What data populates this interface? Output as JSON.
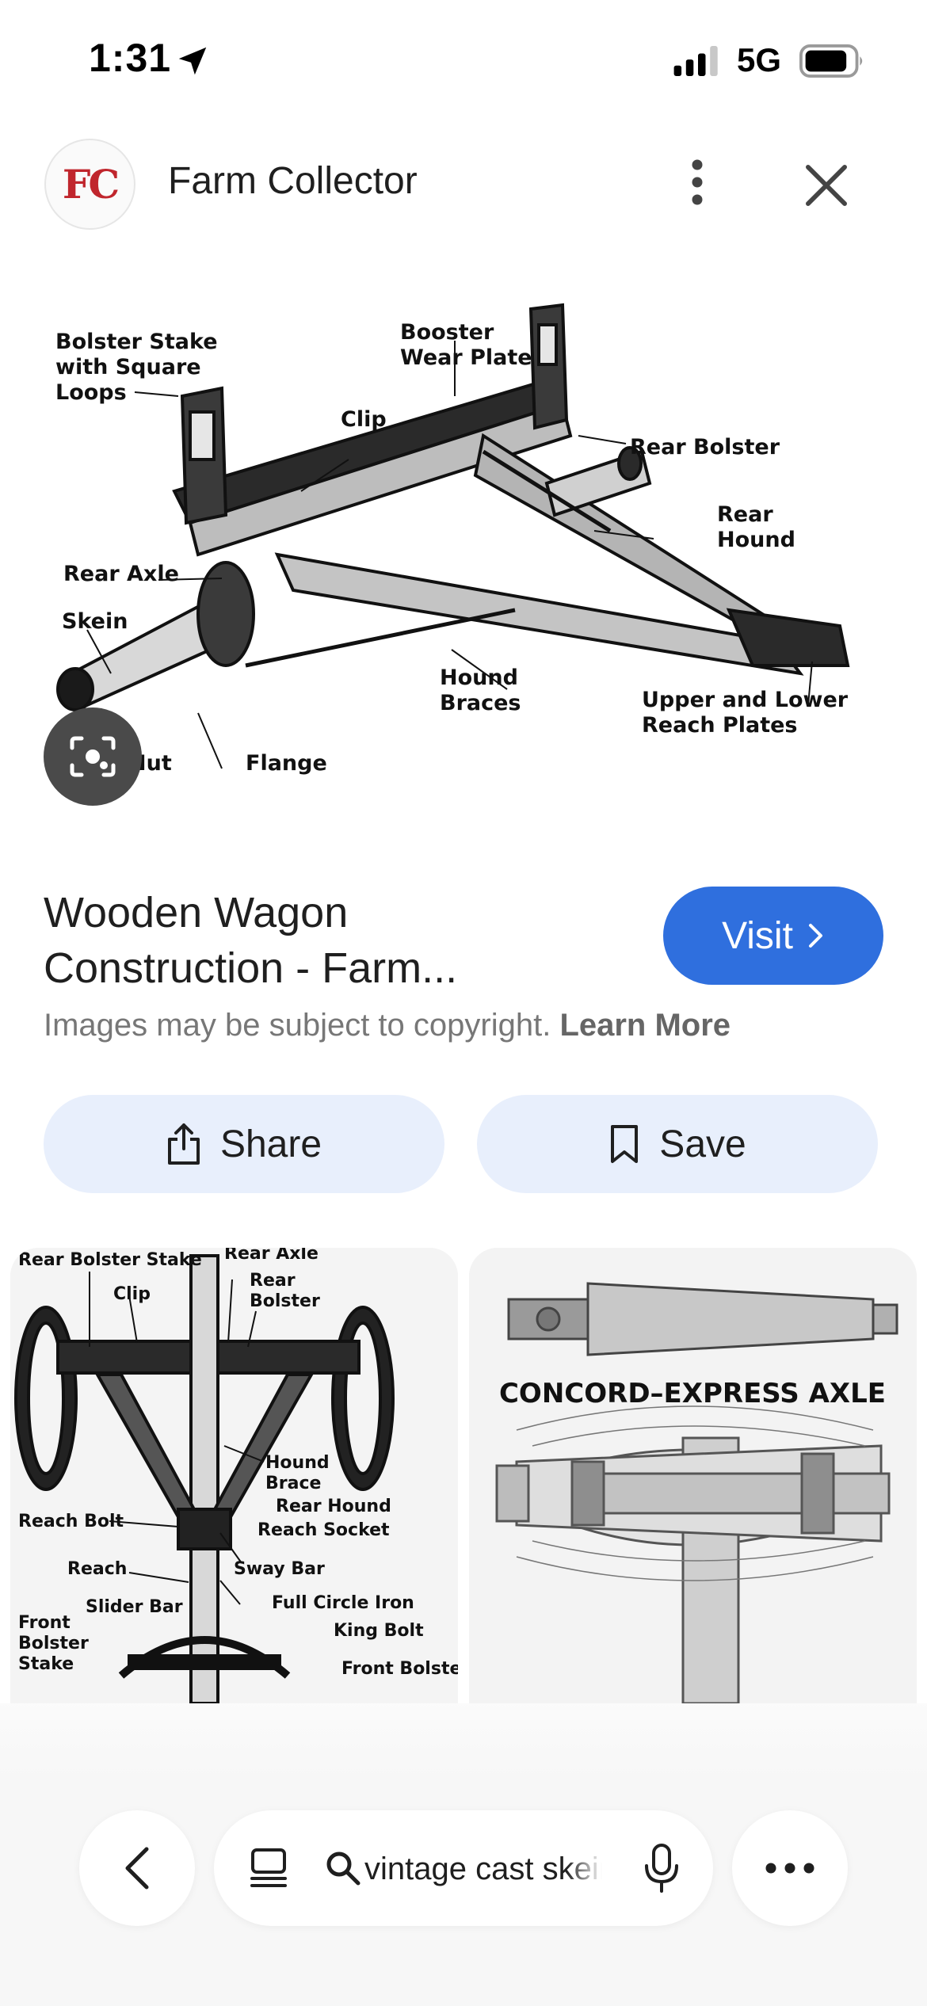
{
  "status_bar": {
    "time": "1:31",
    "network": "5G",
    "icons": [
      "location-arrow-icon",
      "cellular-signal-icon",
      "battery-icon"
    ]
  },
  "header": {
    "logo_text": "FC",
    "site_name": "Farm Collector",
    "logo_color": "#c0262d",
    "icons": [
      "more-vertical-icon",
      "close-icon"
    ]
  },
  "main_image": {
    "labels": {
      "bolster_stake": [
        "Bolster Stake",
        "with Square",
        "Loops"
      ],
      "booster_wear_plate": [
        "Booster",
        "Wear Plate"
      ],
      "clip": "Clip",
      "rear_bolster": "Rear Bolster",
      "rear_hound": [
        "Rear",
        "Hound"
      ],
      "rear_axle": "Rear Axle",
      "skein": "Skein",
      "hound_braces": [
        "Hound",
        "Braces"
      ],
      "reach_plates": [
        "Upper and Lower",
        "Reach Plates"
      ],
      "nut": "Nut",
      "flange": "Flange"
    }
  },
  "result": {
    "title_line1": "Wooden Wagon",
    "title_line2": "Construction - Farm...",
    "visit_label": "Visit",
    "copyright_text": "Images may be subject to copyright.",
    "learn_more": "Learn More",
    "accent_color": "#2f6fde"
  },
  "actions": {
    "share_label": "Share",
    "save_label": "Save"
  },
  "related": {
    "thumb1_labels": {
      "rear_bolster_stake": "Rear Bolster Stake",
      "rear_axle": "Rear Axle",
      "rear_bolster": [
        "Rear",
        "Bolster"
      ],
      "clip": "Clip",
      "hound_brace": [
        "Hound",
        "Brace"
      ],
      "rear_hound": "Rear Hound",
      "reach_socket": "Reach Socket",
      "reach_bolt": "Reach Bolt",
      "reach": "Reach",
      "sway_bar": "Sway Bar",
      "slider_bar": "Slider Bar",
      "full_circle_iron": "Full Circle Iron",
      "king_bolt": "King Bolt",
      "front_bolster_stake": [
        "Front",
        "Bolster",
        "Stake"
      ],
      "front_bolster": "Front Bolster"
    },
    "thumb2_title": "CONCORD–EXPRESS AXLE"
  },
  "bottom_bar": {
    "search_query": "vintage cast skein",
    "icons": [
      "back-chevron-icon",
      "tabs-icon",
      "search-icon",
      "microphone-icon",
      "more-horizontal-icon"
    ]
  }
}
